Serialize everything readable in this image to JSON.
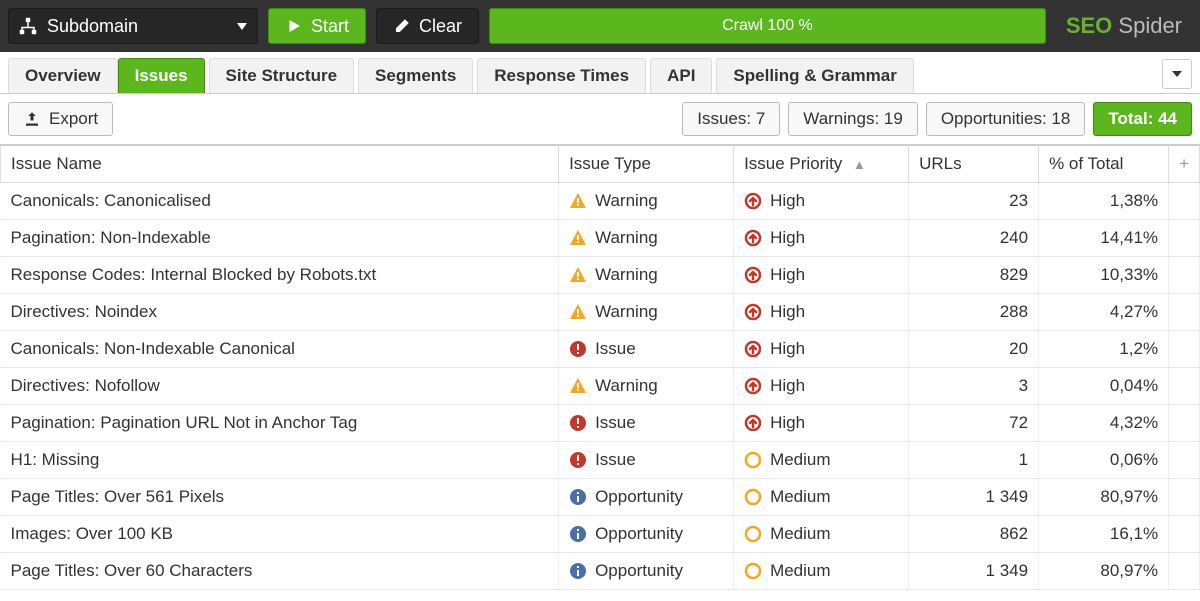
{
  "toolbar": {
    "mode_label": "Subdomain",
    "start_label": "Start",
    "clear_label": "Clear",
    "crawl_status": "Crawl 100 %",
    "brand_seo": "SEO",
    "brand_spider": "Spider"
  },
  "tabs": [
    {
      "label": "Overview",
      "active": false
    },
    {
      "label": "Issues",
      "active": true
    },
    {
      "label": "Site Structure",
      "active": false
    },
    {
      "label": "Segments",
      "active": false
    },
    {
      "label": "Response Times",
      "active": false
    },
    {
      "label": "API",
      "active": false
    },
    {
      "label": "Spelling & Grammar",
      "active": false
    }
  ],
  "subbar": {
    "export_label": "Export",
    "issues": {
      "label": "Issues",
      "value": "7"
    },
    "warnings": {
      "label": "Warnings",
      "value": "19"
    },
    "opportunities": {
      "label": "Opportunities",
      "value": "18"
    },
    "total": {
      "label": "Total",
      "value": "44"
    }
  },
  "columns": {
    "name": "Issue Name",
    "type": "Issue Type",
    "priority": "Issue Priority",
    "urls": "URLs",
    "pct": "% of Total",
    "plus": "+"
  },
  "rows": [
    {
      "name": "Canonicals: Canonicalised",
      "type": "Warning",
      "priority": "High",
      "urls": "23",
      "pct": "1,38%"
    },
    {
      "name": "Pagination: Non-Indexable",
      "type": "Warning",
      "priority": "High",
      "urls": "240",
      "pct": "14,41%"
    },
    {
      "name": "Response Codes: Internal Blocked by Robots.txt",
      "type": "Warning",
      "priority": "High",
      "urls": "829",
      "pct": "10,33%"
    },
    {
      "name": "Directives: Noindex",
      "type": "Warning",
      "priority": "High",
      "urls": "288",
      "pct": "4,27%"
    },
    {
      "name": "Canonicals: Non-Indexable Canonical",
      "type": "Issue",
      "priority": "High",
      "urls": "20",
      "pct": "1,2%"
    },
    {
      "name": "Directives: Nofollow",
      "type": "Warning",
      "priority": "High",
      "urls": "3",
      "pct": "0,04%"
    },
    {
      "name": "Pagination: Pagination URL Not in Anchor Tag",
      "type": "Issue",
      "priority": "High",
      "urls": "72",
      "pct": "4,32%"
    },
    {
      "name": "H1: Missing",
      "type": "Issue",
      "priority": "Medium",
      "urls": "1",
      "pct": "0,06%"
    },
    {
      "name": "Page Titles: Over 561 Pixels",
      "type": "Opportunity",
      "priority": "Medium",
      "urls": "1 349",
      "pct": "80,97%"
    },
    {
      "name": "Images: Over 100 KB",
      "type": "Opportunity",
      "priority": "Medium",
      "urls": "862",
      "pct": "16,1%"
    },
    {
      "name": "Page Titles: Over 60 Characters",
      "type": "Opportunity",
      "priority": "Medium",
      "urls": "1 349",
      "pct": "80,97%"
    }
  ]
}
